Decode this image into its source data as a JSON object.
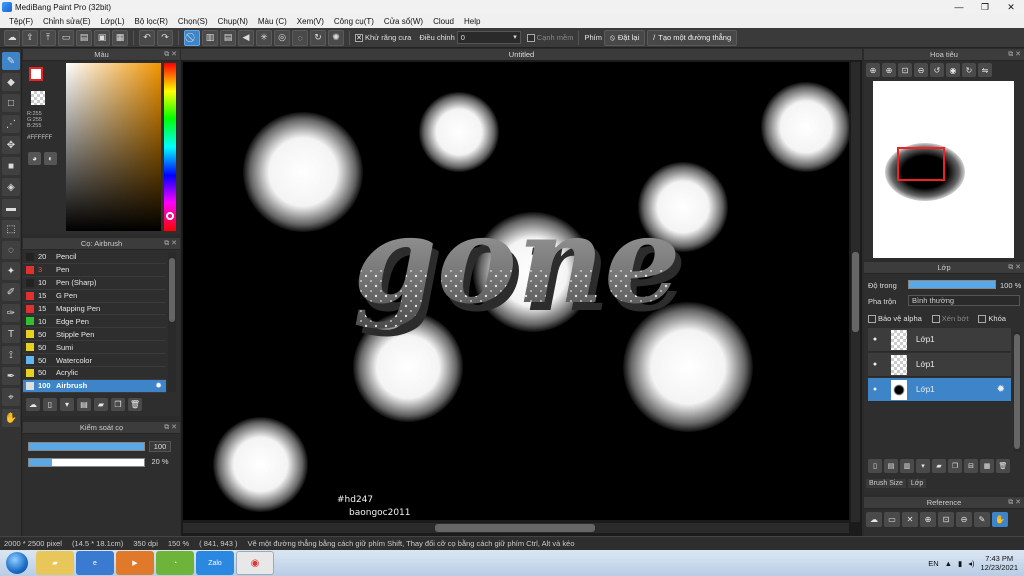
{
  "window": {
    "title": "MediBang Paint Pro (32bit)"
  },
  "menu": [
    "Tệp(F)",
    "Chỉnh sửa(E)",
    "Lớp(L)",
    "Bộ lọc(R)",
    "Chọn(S)",
    "Chụp(N)",
    "Màu (C)",
    "Xem(V)",
    "Công cụ(T)",
    "Cửa sổ(W)",
    "Cloud",
    "Help"
  ],
  "toolbar": {
    "antialias_label": "Khử răng cưa",
    "adjust_label": "Điều chỉnh",
    "adjust_value": "0",
    "edge_label": "Cạnh mềm",
    "shortcut_label": "Phím",
    "reset_label": "Đặt lại",
    "line_label": "Tạo một đường thẳng"
  },
  "color_panel": {
    "title": "Màu",
    "rgb": [
      "R:255",
      "G:255",
      "B:255"
    ],
    "hex": "#FFFFFF",
    "fg_color": "#ffffff",
    "accent": "#f29500"
  },
  "brush_panel": {
    "title": "Cọ: Airbrush",
    "items": [
      {
        "size": "20",
        "name": "Pencil",
        "color": "#222222"
      },
      {
        "size": "3",
        "name": "Pen",
        "color": "#e03030"
      },
      {
        "size": "10",
        "name": "Pen (Sharp)",
        "color": "#222222"
      },
      {
        "size": "15",
        "name": "G Pen",
        "color": "#e03030"
      },
      {
        "size": "15",
        "name": "Mapping Pen",
        "color": "#e03030"
      },
      {
        "size": "10",
        "name": "Edge Pen",
        "color": "#30c030"
      },
      {
        "size": "50",
        "name": "Stipple Pen",
        "color": "#e8d020"
      },
      {
        "size": "50",
        "name": "Sumi",
        "color": "#e8d020"
      },
      {
        "size": "50",
        "name": "Watercolor",
        "color": "#60b8f0"
      },
      {
        "size": "50",
        "name": "Acrylic",
        "color": "#e8d020"
      },
      {
        "size": "100",
        "name": "Airbrush",
        "color": "#dddddd"
      }
    ]
  },
  "brush_control": {
    "title": "Kiểm soát cọ",
    "size_value": "100",
    "size_fraction": 1.0,
    "opacity_value": "20 %",
    "opacity_fraction": 0.2
  },
  "document": {
    "tab": "Untitled",
    "artwork_text": "gone",
    "tag": "#hd247",
    "credit": "baongoc2011"
  },
  "navigator": {
    "title": "Hoa tiêu"
  },
  "layer_panel": {
    "title": "Lớp",
    "opacity_label": "Độ trong",
    "opacity_value": "100 %",
    "blend_label": "Pha trộn",
    "blend_value": "Bình thường",
    "protect_alpha": "Bảo vệ alpha",
    "clipping": "Xén bớt",
    "lock": "Khóa",
    "layers": [
      {
        "name": "Lớp1"
      },
      {
        "name": "Lớp1"
      },
      {
        "name": "Lớp1"
      }
    ],
    "tabs": [
      "Brush Size",
      "Lớp"
    ]
  },
  "reference": {
    "title": "Reference"
  },
  "status": {
    "size": "2000 * 2500 pixel",
    "cm": "(14.5 * 18.1cm)",
    "dpi": "350 dpi",
    "zoom": "150 %",
    "coords": "( 841, 943 )",
    "hint": "Vẽ một đường thẳng bằng cách giữ phím Shift, Thay đổi cỡ cọ bằng cách giữ phím Ctrl, Alt và kéo"
  },
  "taskbar": {
    "lang": "EN",
    "time": "7:43 PM",
    "date": "12/23/2021",
    "zalo": "Zalo"
  }
}
